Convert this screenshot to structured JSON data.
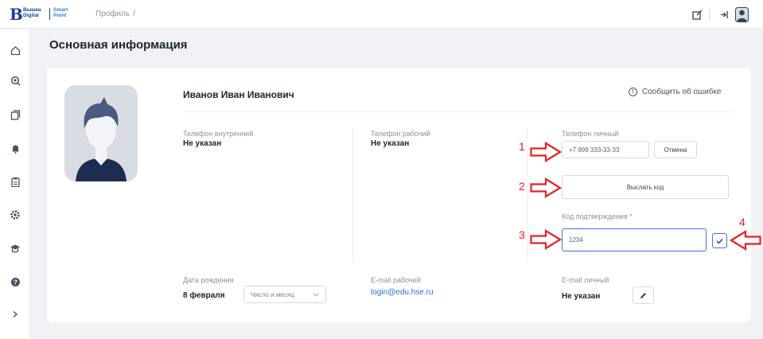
{
  "topbar": {
    "logo_mark": "В",
    "logo_line1": "Вышка",
    "logo_line2": "Digital",
    "logo_line3": "Smart",
    "logo_line4": "Point",
    "breadcrumb": "Профиль",
    "breadcrumb_sep": "/"
  },
  "sidebar": {
    "items": [
      "home-icon",
      "search-icon",
      "files-icon",
      "bell-icon",
      "clipboard-icon",
      "settings-icon",
      "education-icon",
      "help-icon",
      "expand-icon"
    ]
  },
  "main": {
    "title": "Основная информация",
    "fullname": "Иванов Иван Иванович",
    "report_error": "Сообщить об ошибке",
    "phone_internal_label": "Телефон внутренний",
    "phone_internal_value": "Не указан",
    "phone_work_label": "Телефон рабочий",
    "phone_work_value": "Не указан",
    "phone_personal_label": "Телефон личный",
    "phone_personal_value": "+7 999 333-33-33",
    "cancel_label": "Отмена",
    "send_code_label": "Выслать код",
    "code_label": "Код подтверждения *",
    "code_value": "1234",
    "birth_label": "Дата рождения",
    "birth_value": "8 февраля",
    "birth_select": "Число и месяц",
    "email_work_label": "E-mail рабочий",
    "email_work_value": "login@edu.hse.ru",
    "email_personal_label": "E-mail личный",
    "email_personal_value": "Не указан"
  },
  "annotations": [
    "1",
    "2",
    "3",
    "4"
  ],
  "colors": {
    "brand": "#1b3f95",
    "accent": "#3b74d9",
    "annotation": "#e52323",
    "link": "#2d6fd6"
  }
}
